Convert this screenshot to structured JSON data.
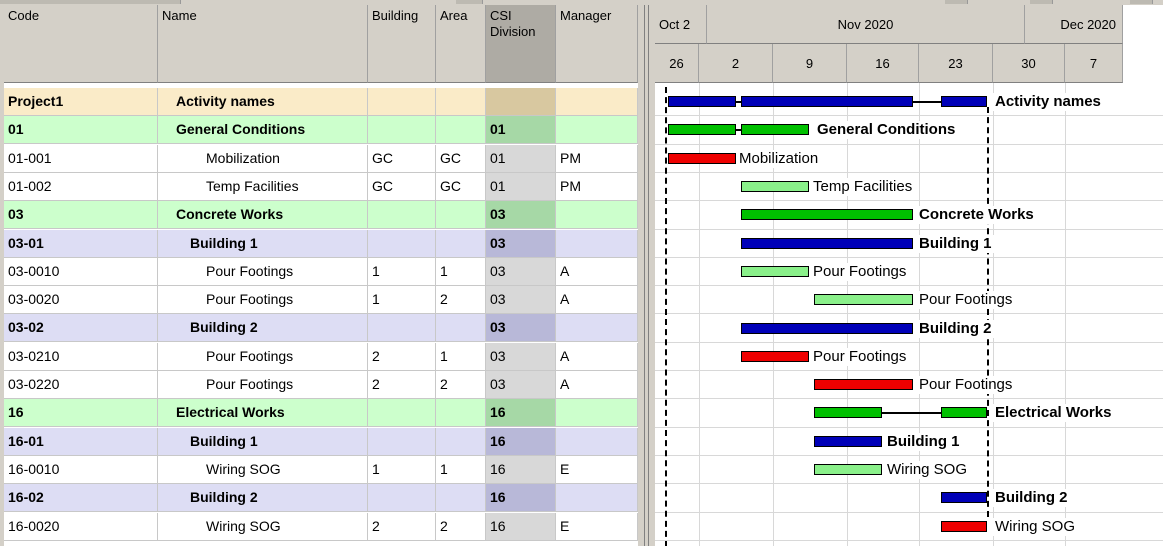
{
  "colors": {
    "header_bg": "#d4d0c8",
    "csi_header_bg": "#aeaba4",
    "project_row_bg": "#faebc8",
    "division_row_bg": "#ccffcc",
    "building_row_bg": "#ddddf4",
    "csi_project_bg": "#d8c8a0",
    "csi_division_bg": "#a6d8a6",
    "csi_building_bg": "#b8b8d8",
    "csi_activity_bg": "#d8d8d8",
    "bar_blue": "#0000b8",
    "bar_green": "#00c000",
    "bar_lightgreen": "#8af08a",
    "bar_red": "#ee0000"
  },
  "columns": [
    {
      "key": "code",
      "label": "Code"
    },
    {
      "key": "name",
      "label": "Name"
    },
    {
      "key": "building",
      "label": "Building"
    },
    {
      "key": "area",
      "label": "Area"
    },
    {
      "key": "csi",
      "label": "CSI Division"
    },
    {
      "key": "manager",
      "label": "Manager"
    }
  ],
  "timeline": {
    "months": [
      "Oct 2",
      "Nov 2020",
      "Dec 2020"
    ],
    "weeks": [
      "26",
      "2",
      "9",
      "16",
      "23",
      "30",
      "7"
    ]
  },
  "rows": [
    {
      "type": "project",
      "code": "Project1",
      "name": "Activity names",
      "building": "",
      "area": "",
      "csi": "",
      "manager": "",
      "bar_label": "Activity names",
      "bar_color": "blue"
    },
    {
      "type": "division",
      "code": "01",
      "name": "General Conditions",
      "building": "",
      "area": "",
      "csi": "01",
      "manager": "",
      "bar_label": "General Conditions",
      "bar_color": "green"
    },
    {
      "type": "activity",
      "code": "01-001",
      "name": "Mobilization",
      "building": "GC",
      "area": "GC",
      "csi": "01",
      "manager": "PM",
      "bar_label": "Mobilization",
      "bar_color": "red"
    },
    {
      "type": "activity",
      "code": "01-002",
      "name": "Temp Facilities",
      "building": "GC",
      "area": "GC",
      "csi": "01",
      "manager": "PM",
      "bar_label": "Temp Facilities",
      "bar_color": "lightgreen"
    },
    {
      "type": "division",
      "code": "03",
      "name": "Concrete Works",
      "building": "",
      "area": "",
      "csi": "03",
      "manager": "",
      "bar_label": "Concrete Works",
      "bar_color": "green"
    },
    {
      "type": "building",
      "code": "03-01",
      "name": "Building 1",
      "building": "",
      "area": "",
      "csi": "03",
      "manager": "",
      "bar_label": "Building 1",
      "bar_color": "blue"
    },
    {
      "type": "activity",
      "code": "03-0010",
      "name": "Pour Footings",
      "building": "1",
      "area": "1",
      "csi": "03",
      "manager": "A",
      "bar_label": "Pour Footings",
      "bar_color": "lightgreen"
    },
    {
      "type": "activity",
      "code": "03-0020",
      "name": "Pour Footings",
      "building": "1",
      "area": "2",
      "csi": "03",
      "manager": "A",
      "bar_label": "Pour Footings",
      "bar_color": "lightgreen"
    },
    {
      "type": "building",
      "code": "03-02",
      "name": "Building 2",
      "building": "",
      "area": "",
      "csi": "03",
      "manager": "",
      "bar_label": "Building 2",
      "bar_color": "blue"
    },
    {
      "type": "activity",
      "code": "03-0210",
      "name": "Pour Footings",
      "building": "2",
      "area": "1",
      "csi": "03",
      "manager": "A",
      "bar_label": "Pour Footings",
      "bar_color": "red"
    },
    {
      "type": "activity",
      "code": "03-0220",
      "name": "Pour Footings",
      "building": "2",
      "area": "2",
      "csi": "03",
      "manager": "A",
      "bar_label": "Pour Footings",
      "bar_color": "red"
    },
    {
      "type": "division",
      "code": "16",
      "name": "Electrical Works",
      "building": "",
      "area": "",
      "csi": "16",
      "manager": "",
      "bar_label": "Electrical Works",
      "bar_color": "green"
    },
    {
      "type": "building",
      "code": "16-01",
      "name": "Building 1",
      "building": "",
      "area": "",
      "csi": "16",
      "manager": "",
      "bar_label": "Building 1",
      "bar_color": "blue"
    },
    {
      "type": "activity",
      "code": "16-0010",
      "name": "Wiring SOG",
      "building": "1",
      "area": "1",
      "csi": "16",
      "manager": "E",
      "bar_label": "Wiring SOG",
      "bar_color": "lightgreen"
    },
    {
      "type": "building",
      "code": "16-02",
      "name": "Building 2",
      "building": "",
      "area": "",
      "csi": "16",
      "manager": "",
      "bar_label": "Building 2",
      "bar_color": "blue"
    },
    {
      "type": "activity",
      "code": "16-0020",
      "name": "Wiring SOG",
      "building": "2",
      "area": "2",
      "csi": "16",
      "manager": "E",
      "bar_label": "Wiring SOG",
      "bar_color": "red"
    }
  ]
}
